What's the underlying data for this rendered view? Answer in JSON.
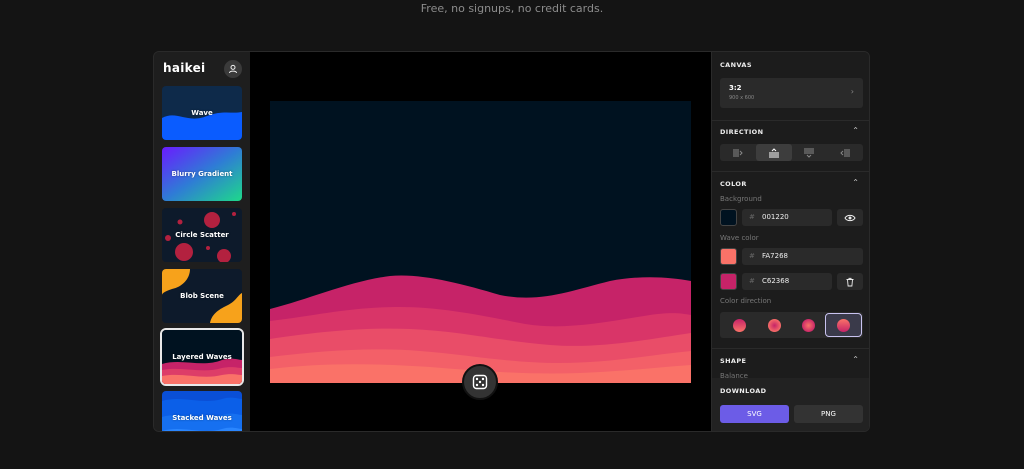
{
  "tagline": "Free, no signups, no credit cards.",
  "brand": {
    "logo": "haikei"
  },
  "sidebar": {
    "items": [
      {
        "label": "Wave"
      },
      {
        "label": "Blurry Gradient"
      },
      {
        "label": "Circle Scatter"
      },
      {
        "label": "Blob Scene"
      },
      {
        "label": "Layered Waves"
      },
      {
        "label": "Stacked Waves"
      }
    ]
  },
  "panel": {
    "canvas": {
      "title": "CANVAS",
      "ratio": "3:2",
      "size": "900 x 600"
    },
    "direction": {
      "title": "DIRECTION"
    },
    "color": {
      "title": "COLOR",
      "background_label": "Background",
      "background_value": "001220",
      "wave_label": "Wave color",
      "wave_colors": [
        "FA7268",
        "C62368"
      ],
      "hash": "#",
      "direction_label": "Color direction"
    },
    "shape": {
      "title": "SHAPE",
      "balance_label": "Balance"
    },
    "download": {
      "title": "DOWNLOAD",
      "svg_label": "SVG",
      "png_label": "PNG"
    }
  },
  "colors": {
    "background": "#001220",
    "wave_start": "#FA7268",
    "wave_end": "#C62368",
    "accent": "#6c5ce7"
  }
}
